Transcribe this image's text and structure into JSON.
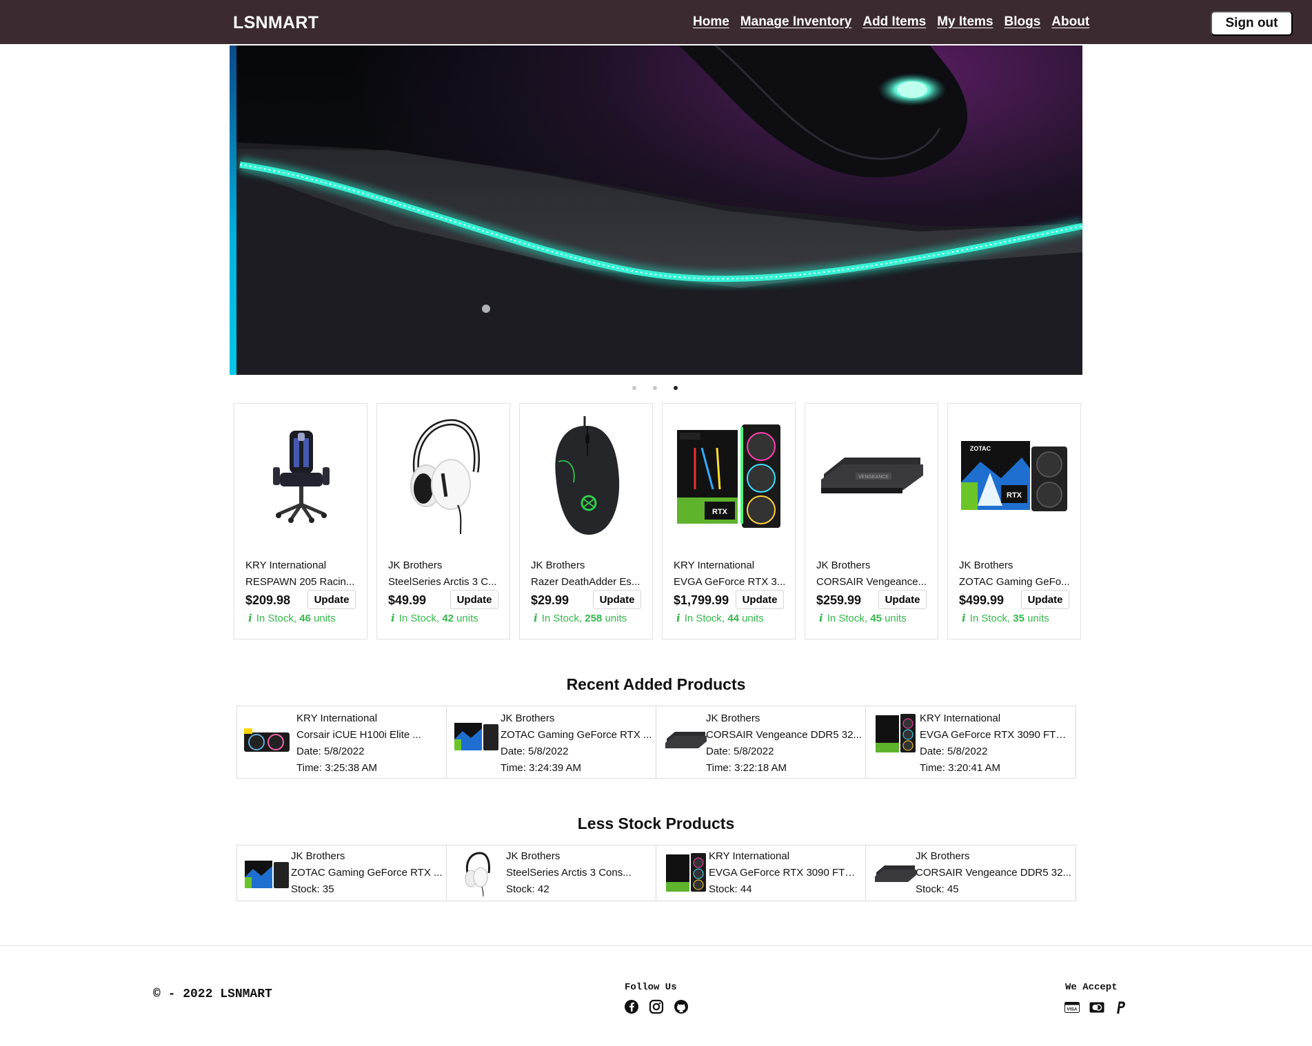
{
  "nav": {
    "brand": "LSNMART",
    "links": [
      "Home",
      "Manage Inventory",
      "Add Items",
      "My Items",
      "Blogs",
      "About"
    ],
    "signout": "Sign out"
  },
  "carousel": {
    "slides": 3,
    "active_index": 2
  },
  "products": [
    {
      "supplier": "KRY International",
      "name": "RESPAWN 205 Racin...",
      "price": "$209.98",
      "update": "Update",
      "stock_prefix": "In Stock,",
      "stock_qty": "46",
      "stock_unit": "units",
      "icon": "gaming-chair-icon"
    },
    {
      "supplier": "JK Brothers",
      "name": "SteelSeries Arctis 3 C...",
      "price": "$49.99",
      "update": "Update",
      "stock_prefix": "In Stock,",
      "stock_qty": "42",
      "stock_unit": "units",
      "icon": "headset-icon"
    },
    {
      "supplier": "JK Brothers",
      "name": "Razer DeathAdder Es...",
      "price": "$29.99",
      "update": "Update",
      "stock_prefix": "In Stock,",
      "stock_qty": "258",
      "stock_unit": "units",
      "icon": "mouse-icon"
    },
    {
      "supplier": "KRY International",
      "name": "EVGA GeForce RTX 3...",
      "price": "$1,799.99",
      "update": "Update",
      "stock_prefix": "In Stock,",
      "stock_qty": "44",
      "stock_unit": "units",
      "icon": "graphics-card-icon"
    },
    {
      "supplier": "JK Brothers",
      "name": "CORSAIR Vengeance...",
      "price": "$259.99",
      "update": "Update",
      "stock_prefix": "In Stock,",
      "stock_qty": "45",
      "stock_unit": "units",
      "icon": "ram-icon"
    },
    {
      "supplier": "JK Brothers",
      "name": "ZOTAC Gaming GeFo...",
      "price": "$499.99",
      "update": "Update",
      "stock_prefix": "In Stock,",
      "stock_qty": "35",
      "stock_unit": "units",
      "icon": "graphics-card-box-icon"
    }
  ],
  "recent": {
    "title": "Recent Added Products",
    "items": [
      {
        "supplier": "KRY International",
        "name": "Corsair iCUE H100i Elite ...",
        "date": "Date: 5/8/2022",
        "time": "Time: 3:25:38 AM",
        "icon": "cpu-cooler-icon"
      },
      {
        "supplier": "JK Brothers",
        "name": "ZOTAC Gaming GeForce RTX ...",
        "date": "Date: 5/8/2022",
        "time": "Time: 3:24:39 AM",
        "icon": "graphics-card-box-icon"
      },
      {
        "supplier": "JK Brothers",
        "name": "CORSAIR Vengeance DDR5 32...",
        "date": "Date: 5/8/2022",
        "time": "Time: 3:22:18 AM",
        "icon": "ram-icon"
      },
      {
        "supplier": "KRY International",
        "name": "EVGA GeForce RTX 3090 FTW...",
        "date": "Date: 5/8/2022",
        "time": "Time: 3:20:41 AM",
        "icon": "graphics-card-icon"
      }
    ]
  },
  "less_stock": {
    "title": "Less Stock Products",
    "items": [
      {
        "supplier": "JK Brothers",
        "name": "ZOTAC Gaming GeForce RTX ...",
        "stock": "Stock: 35",
        "icon": "graphics-card-box-icon"
      },
      {
        "supplier": "JK Brothers",
        "name": "SteelSeries Arctis 3 Cons...",
        "stock": "Stock: 42",
        "icon": "headset-icon"
      },
      {
        "supplier": "KRY International",
        "name": "EVGA GeForce RTX 3090 FTW...",
        "stock": "Stock: 44",
        "icon": "graphics-card-icon"
      },
      {
        "supplier": "JK Brothers",
        "name": "CORSAIR Vengeance DDR5 32...",
        "stock": "Stock: 45",
        "icon": "ram-icon"
      }
    ]
  },
  "footer": {
    "copyright": "© - 2022 LSNMART",
    "follow": "Follow Us",
    "accept": "We Accept",
    "social": [
      "facebook-icon",
      "instagram-icon",
      "github-icon"
    ],
    "payments": [
      "visa-icon",
      "mastercard-icon",
      "paypal-icon"
    ]
  },
  "colors": {
    "navbar": "#3b2a2f",
    "in_stock": "#34b84a",
    "accent_glow": "#25e0c3"
  }
}
